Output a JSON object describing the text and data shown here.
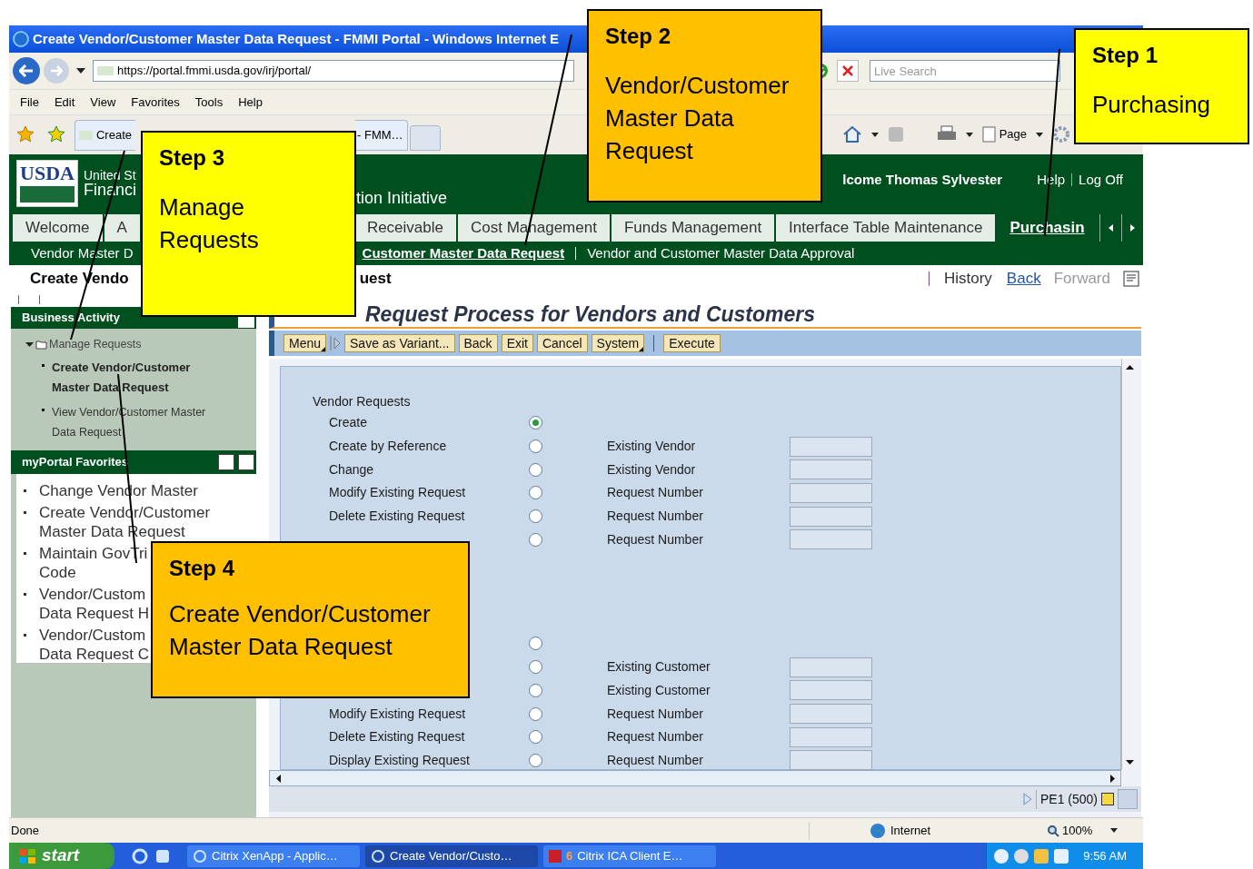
{
  "browser": {
    "title": "Create Vendor/Customer Master Data Request - FMMI Portal - Windows Internet E",
    "address": "https://portal.fmmi.usda.gov/irj/portal/",
    "search_placeholder": "Live Search",
    "menu": [
      "File",
      "Edit",
      "View",
      "Favorites",
      "Tools",
      "Help"
    ],
    "tab_label_start": "Create",
    "tab_label_end": "- FMM…",
    "page_menu": "Page"
  },
  "portal": {
    "logo": "USDA",
    "org_line1": "United St",
    "org_line2": "Financi",
    "org_line2_end": "tion Initiative",
    "welcome": "lcome Thomas Sylvester",
    "links": [
      "Help",
      "Log Off"
    ],
    "top_nav": [
      {
        "label": "Welcome",
        "selected": false
      },
      {
        "label": "A",
        "selected": false
      },
      {
        "label": "Receivable",
        "selected": false
      },
      {
        "label": "Cost Management",
        "selected": false
      },
      {
        "label": "Funds Management",
        "selected": false
      },
      {
        "label": "Interface Table Maintenance",
        "selected": false
      },
      {
        "label": "Purchasin",
        "selected": true
      }
    ],
    "sub_nav": [
      {
        "label": "Vendor Master D",
        "selected": false
      },
      {
        "label": "Customer Master Data Request",
        "selected": true
      },
      {
        "label": "Vendor and Customer Master Data Approval",
        "selected": false
      }
    ],
    "page_title_start": "Create Vendo",
    "page_title_end": "uest",
    "history": "History",
    "back": "Back",
    "forward": "Forward"
  },
  "business_activity": {
    "title": "Business Activity",
    "tree": [
      {
        "label": "Manage Requests",
        "expanded": true,
        "children": [
          {
            "label": "Create Vendor/Customer Master Data Request",
            "selected": true
          },
          {
            "label": "View Vendor/Customer Master Data Request",
            "selected": false
          }
        ]
      }
    ]
  },
  "favorites": {
    "title": "myPortal Favorites",
    "items": [
      {
        "lines": [
          "Change Vendor Master"
        ]
      },
      {
        "lines": [
          "Create Vendor/Customer",
          "Master Data Request"
        ]
      },
      {
        "lines": [
          "Maintain GovTri",
          "Code"
        ]
      },
      {
        "lines": [
          "Vendor/Custom",
          "Data Request H"
        ]
      },
      {
        "lines": [
          "Vendor/Custom",
          "Data Request C"
        ]
      }
    ]
  },
  "main": {
    "title": "Request Process for Vendors and Customers",
    "toolbar": [
      {
        "label": "Menu",
        "kind": "menu"
      },
      {
        "label": "Save as Variant...",
        "kind": "button"
      },
      {
        "label": "Back",
        "kind": "button"
      },
      {
        "label": "Exit",
        "kind": "button"
      },
      {
        "label": "Cancel",
        "kind": "button"
      },
      {
        "label": "System",
        "kind": "menu"
      },
      {
        "label": "Execute",
        "kind": "button"
      }
    ],
    "vendor_heading": "Vendor Requests",
    "vendor_rows": [
      {
        "label": "Create",
        "selected": true
      },
      {
        "label": "Create by Reference",
        "selected": false,
        "field_label": "Existing Vendor"
      },
      {
        "label": "Change",
        "selected": false,
        "field_label": "Existing Vendor"
      },
      {
        "label": "Modify Existing Request",
        "selected": false,
        "field_label": "Request Number"
      },
      {
        "label": "Delete Existing Request",
        "selected": false,
        "field_label": "Request Number"
      },
      {
        "selected": false,
        "field_label": "Request Number"
      }
    ],
    "customer_rows": [
      {
        "selected": false
      },
      {
        "selected": false,
        "field_label": "Existing Customer"
      },
      {
        "selected": false,
        "field_label": "Existing Customer"
      },
      {
        "label": "Modify Existing Request",
        "selected": false,
        "field_label": "Request Number"
      },
      {
        "label": "Delete Existing Request",
        "selected": false,
        "field_label": "Request Number"
      },
      {
        "label": "Display Existing Request",
        "selected": false,
        "field_label": "Request Number"
      }
    ],
    "system_info": "PE1 (500)"
  },
  "ie_status": {
    "text": "Done",
    "zone": "Internet",
    "zoom": "100%"
  },
  "taskbar": {
    "start": "start",
    "tasks": [
      {
        "label": "Citrix XenApp - Applic…",
        "selected": false
      },
      {
        "label": "Create Vendor/Custo…",
        "selected": true
      },
      {
        "count": "6",
        "label": "Citrix ICA Client E…",
        "selected": false
      }
    ],
    "clock": "9:56 AM"
  },
  "callouts": [
    {
      "step": "Step 1",
      "text": "Purchasing",
      "color": "#ffff00"
    },
    {
      "step": "Step 2",
      "text": "Vendor/Customer Master Data Request",
      "color": "#ffc000"
    },
    {
      "step": "Step 3",
      "text": "Manage Requests",
      "color": "#ffff00"
    },
    {
      "step": "Step 4",
      "text": "Create Vendor/Customer Master Data Request",
      "color": "#ffc000"
    }
  ]
}
